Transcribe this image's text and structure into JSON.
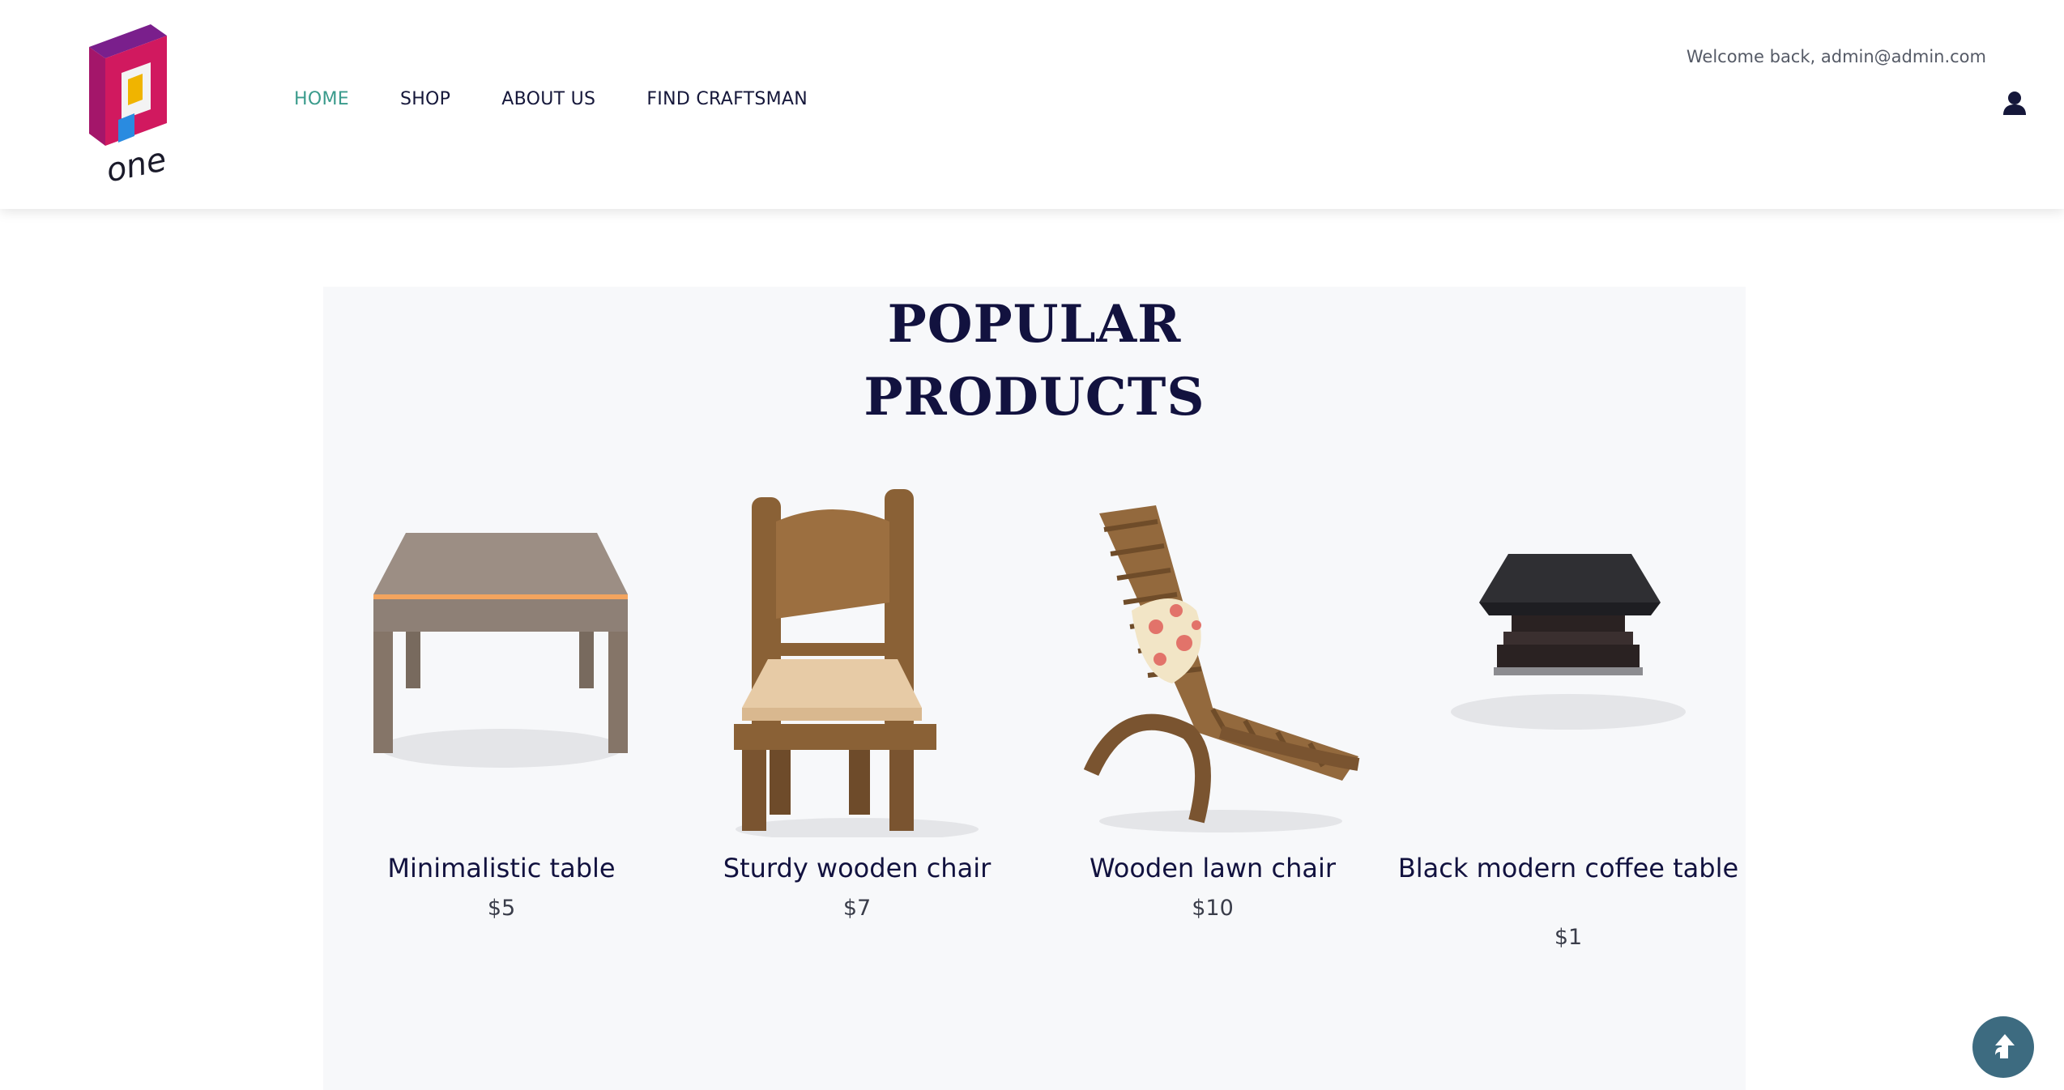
{
  "header": {
    "logo_text": "one",
    "nav": [
      {
        "label": "HOME",
        "active": true
      },
      {
        "label": "SHOP",
        "active": false
      },
      {
        "label": "ABOUT US",
        "active": false
      },
      {
        "label": "FIND CRAFTSMAN",
        "active": false
      }
    ],
    "welcome": "Welcome back, admin@admin.com",
    "user_icon": "user-icon"
  },
  "popular": {
    "title_line1": "POPULAR",
    "title_line2": "PRODUCTS",
    "products": [
      {
        "name": "Minimalistic table",
        "price": "$5",
        "image": "table-image"
      },
      {
        "name": "Sturdy wooden chair",
        "price": "$7",
        "image": "chair-image"
      },
      {
        "name": "Wooden lawn chair",
        "price": "$10",
        "image": "lawn-chair-image"
      },
      {
        "name": "Black modern coffee table",
        "price": "$1",
        "image": "coffee-table-image"
      }
    ]
  },
  "colors": {
    "nav_active": "#3a9b8c",
    "heading": "#12123f",
    "back_to_top": "#3d6b80"
  },
  "back_to_top_icon": "arrow-up-icon"
}
